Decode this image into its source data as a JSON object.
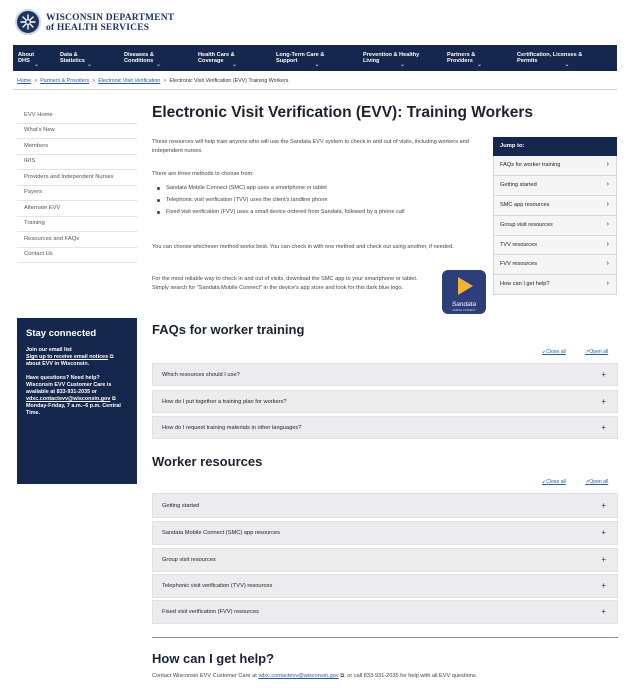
{
  "header": {
    "org_line1": "WISCONSIN DEPARTMENT",
    "org_line2": "of HEALTH SERVICES",
    "brand_color": "#15274d"
  },
  "nav": {
    "items": [
      {
        "line1": "About",
        "line2": "DHS"
      },
      {
        "line1": "Data &",
        "line2": "Statistics"
      },
      {
        "line1": "Diseases &",
        "line2": "Conditions"
      },
      {
        "line1": "Health Care &",
        "line2": "Coverage"
      },
      {
        "line1": "Long-Term Care &",
        "line2": "Support"
      },
      {
        "line1": "Prevention & Healthy",
        "line2": "Living"
      },
      {
        "line1": "Partners &",
        "line2": "Providers"
      },
      {
        "line1": "Certification, Licenses &",
        "line2": "Permits"
      }
    ]
  },
  "breadcrumb": {
    "items": [
      "Home",
      "Partners & Providers",
      "Electronic Visit Verification",
      "Electronic Visit Verification (EVV) Training Workers"
    ],
    "separator": ">"
  },
  "sidebar": {
    "items": [
      "EVV Home",
      "What's New",
      "Members",
      "IRIS",
      "Providers and Independent Nurses",
      "Payers",
      "Alternate EVV",
      "Training",
      "Resources and FAQs",
      "Contact Us"
    ]
  },
  "stay_connected": {
    "title": "Stay connected",
    "email_heading": "Join our email list",
    "email_link": "Sign up to receive email notices",
    "email_rest": "about EVV in Wisconsin.",
    "questions_heading": "Have questions? Need help?",
    "care_text": "Wisconsin EVV Customer Care is available at 833-931-2035 or",
    "email_address": "vdxc.contactevv@wisconsin.gov",
    "hours": "Monday-Friday, 7 a.m.–6 p.m. Central Time."
  },
  "main": {
    "title": "Electronic Visit Verification (EVV): Training Workers",
    "intro": "These resources will help train anyone who will use the Sandata EVV system to check in and out of visits, including workers and independent nurses.",
    "methods_intro": "There are three methods to choose from:",
    "methods": [
      "Sandata Mobile Connect (SMC) app uses a smartphone or tablet",
      "Telephonic visit verification (TVV) uses the client's landline phone",
      "Fixed visit verification (FVV) uses a small device ordered from Sandata, followed by a phone call"
    ],
    "choose_text": "You can choose whichever method works best. You can check in with one method and check out using another, if needed.",
    "reliable_text": "For the most reliable way to check in and out of visits, download the SMC app to your smartphone or tablet. Simply search for \"Sandata Mobile Connect\" in the device's app store and look for this dark blue logo.",
    "app_logo": {
      "brand": "Sandata",
      "sub": "MOBILE CONNECT",
      "color": "#2c3f7a"
    }
  },
  "jump_to": {
    "heading": "Jump to:",
    "items": [
      "FAQs for worker training",
      "Getting started",
      "SMC app resources",
      "Group visit resources",
      "TVV resources",
      "FVV resources",
      "How can I get help?"
    ]
  },
  "faqs": {
    "title": "FAQs for worker training",
    "close_all": "Close all",
    "open_all": "Open all",
    "items": [
      "Which resources should I use?",
      "How do I put together a training plan for workers?",
      "How do I request training materials in other languages?"
    ]
  },
  "worker_resources": {
    "title": "Worker resources",
    "close_all": "Close all",
    "open_all": "Open all",
    "items": [
      "Getting started",
      "Sandata Mobile Connect (SMC) app resources",
      "Group visit resources",
      "Telephonic visit verification (TVV) resources",
      "Fixed visit verification (FVV) resources"
    ]
  },
  "help": {
    "title": "How can I get help?",
    "text_before": "Contact Wisconsin EVV Customer Care at",
    "email": "vdxc.contactevv@wisconsin.gov",
    "text_after": ", or call 833-931-2035 for help with all EVV questions."
  }
}
